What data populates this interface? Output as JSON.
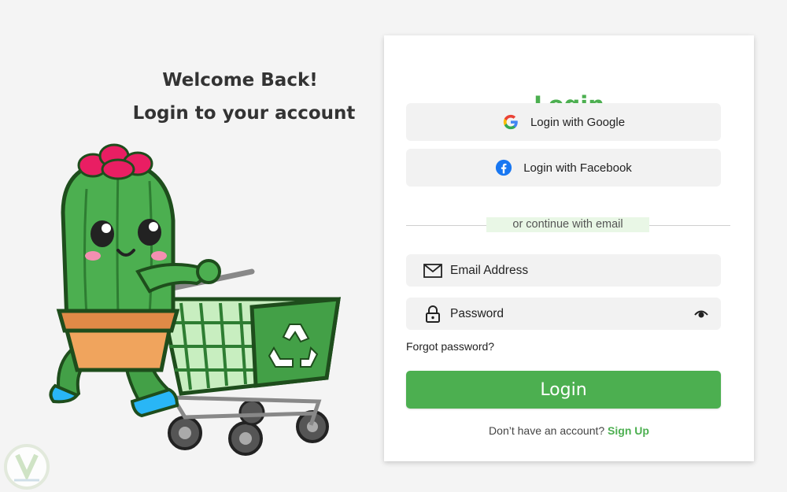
{
  "welcome": {
    "line1": "Welcome Back!",
    "line2": "Login to your account"
  },
  "mascot": {
    "icon": "cactus-shopping-cart-illustration"
  },
  "card": {
    "title": "Login",
    "google_label": "Login with Google",
    "facebook_label": "Login with Facebook",
    "divider_text": "or continue with email",
    "email_placeholder": "Email Address",
    "password_placeholder": "Password",
    "forgot_label": "Forgot password?",
    "login_label": "Login",
    "signup_prompt": "Don’t have an account?",
    "signup_link": "Sign Up"
  },
  "colors": {
    "accent": "#4caf50",
    "background": "#f4f4f4",
    "field_bg": "#f2f2f2",
    "divider_highlight": "#e9f7e6"
  }
}
